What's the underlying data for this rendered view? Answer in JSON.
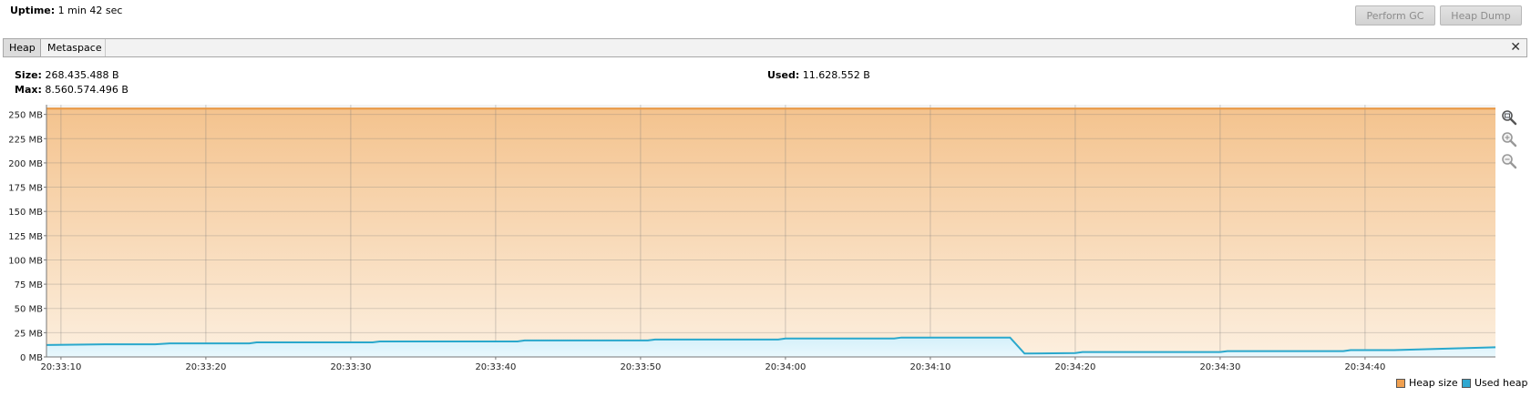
{
  "header": {
    "uptime_label": "Uptime:",
    "uptime_value": "1 min 42 sec",
    "perform_gc_label": "Perform GC",
    "heap_dump_label": "Heap Dump"
  },
  "tabs": {
    "heap_label": "Heap",
    "metaspace_label": "Metaspace",
    "selected": "Heap"
  },
  "stats": {
    "size_label": "Size:",
    "size_value": "268.435.488 B",
    "max_label": "Max:",
    "max_value": "8.560.574.496 B",
    "used_label": "Used:",
    "used_value": "11.628.552 B"
  },
  "icons": {
    "close": "close-icon",
    "zoom_fit": "zoom-fit-icon",
    "zoom_in": "zoom-in-icon",
    "zoom_out": "zoom-out-icon"
  },
  "colors": {
    "heap_size": "#f0a050",
    "used_heap": "#30a8d0"
  },
  "chart_data": {
    "type": "area",
    "y_unit": "MB",
    "ylim": [
      0,
      260
    ],
    "y_ticks": [
      "0 MB",
      "25 MB",
      "50 MB",
      "75 MB",
      "100 MB",
      "125 MB",
      "150 MB",
      "175 MB",
      "200 MB",
      "225 MB",
      "250 MB"
    ],
    "y_tick_values": [
      0,
      25,
      50,
      75,
      100,
      125,
      150,
      175,
      200,
      225,
      250
    ],
    "x_ticks": [
      "20:33:10",
      "20:33:20",
      "20:33:30",
      "20:33:40",
      "20:33:50",
      "20:34:00",
      "20:34:10",
      "20:34:20",
      "20:34:30",
      "20:34:40"
    ],
    "x_range_seconds": [
      -1,
      99
    ],
    "grid": true,
    "legend_position": "bottom-right",
    "series": [
      {
        "name": "Heap size",
        "points": [
          [
            -1,
            256
          ],
          [
            99,
            256
          ]
        ]
      },
      {
        "name": "Used heap",
        "points": [
          [
            -1,
            12.3
          ],
          [
            3,
            13
          ],
          [
            6.5,
            13
          ],
          [
            7.5,
            14
          ],
          [
            13,
            14
          ],
          [
            13.5,
            15
          ],
          [
            21.5,
            15
          ],
          [
            22,
            16
          ],
          [
            31.5,
            16
          ],
          [
            32,
            17
          ],
          [
            40.5,
            17
          ],
          [
            41,
            18
          ],
          [
            49.5,
            18
          ],
          [
            50,
            19
          ],
          [
            57.5,
            19
          ],
          [
            58,
            20
          ],
          [
            65.5,
            20
          ],
          [
            66.5,
            3.5
          ],
          [
            70,
            4
          ],
          [
            70.5,
            5
          ],
          [
            80,
            5
          ],
          [
            80.5,
            6
          ],
          [
            88.5,
            6
          ],
          [
            89,
            7
          ],
          [
            92,
            7
          ],
          [
            99,
            10
          ]
        ]
      }
    ]
  },
  "legend": {
    "heap_size_label": "Heap size",
    "used_heap_label": "Used heap"
  }
}
